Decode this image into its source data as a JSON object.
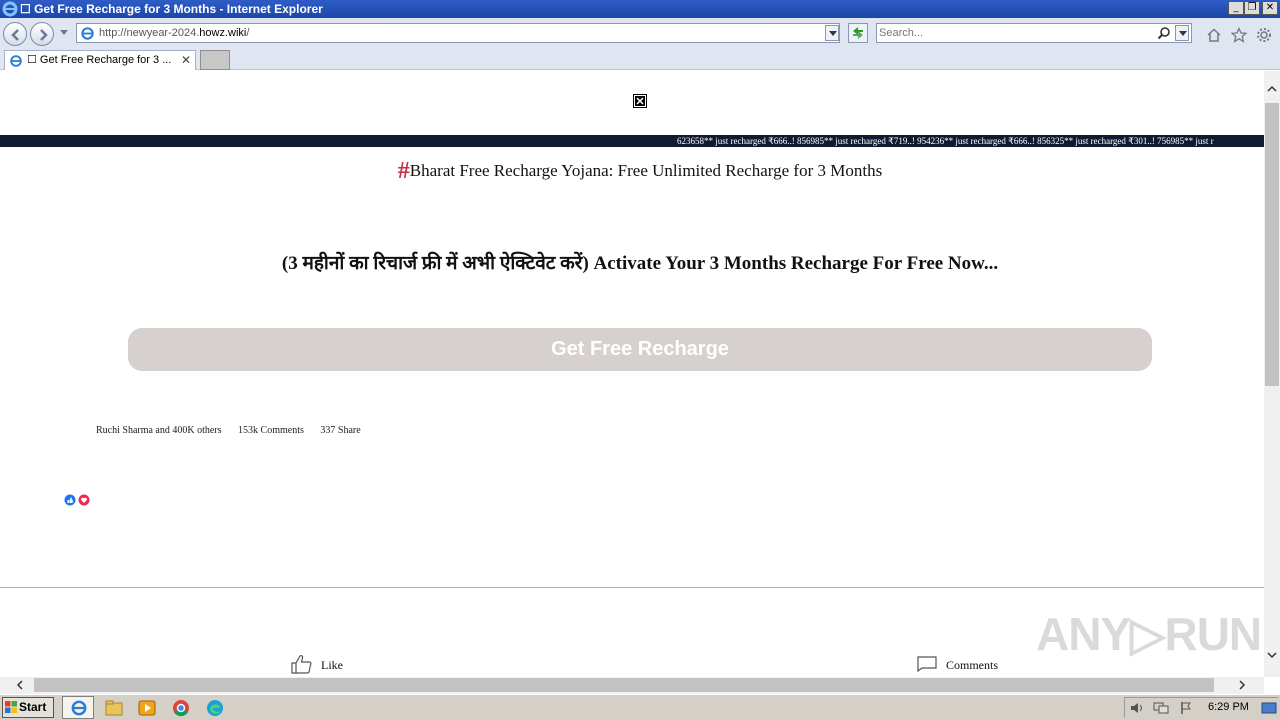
{
  "window": {
    "title": "☐ Get Free Recharge for 3 Months - Internet Explorer",
    "controls": {
      "minimize": "_",
      "restore": "❐",
      "close": "✕"
    }
  },
  "navbar": {
    "url_prefix": "http://newyear-2024.",
    "url_domain": "howz.wiki",
    "url_suffix": "/",
    "search_placeholder": "Search..."
  },
  "tabs": [
    {
      "label": "☐ Get Free Recharge for 3 ...",
      "close": "✕"
    }
  ],
  "page": {
    "ticker": "623658** just recharged ₹666..! 856985** just recharged ₹719..! 954236** just recharged ₹666..! 856325** just recharged ₹301..! 756985** just r",
    "heading_hash": "#",
    "heading": "Bharat Free Recharge Yojana: Free Unlimited Recharge for 3 Months",
    "subheading": "(3 महीनों का रिचार्ज फ्री में अभी ऐक्टिवेट करें) Activate Your 3 Months Recharge For Free Now...",
    "cta_label": "Get Free Recharge",
    "social": {
      "likes": "Ruchi Sharma and 400K others",
      "comments": "153k  Comments",
      "shares": "337  Share"
    },
    "like_label": "Like",
    "comments_label": "Comments",
    "watermark": "ANY▷RUN"
  },
  "taskbar": {
    "start_label": "Start",
    "clock": "6:29 PM"
  },
  "icons": {
    "back": "back-arrow-icon",
    "forward": "forward-arrow-icon",
    "home": "home-icon",
    "favorites": "star-icon",
    "tools": "gear-icon",
    "search": "search-icon",
    "refresh": "refresh-icon"
  },
  "colors": {
    "titlebar": "#1c47a8",
    "ticker_bg": "#0f1a33",
    "hash": "#c0324a",
    "cta_bg": "#d6d1ce",
    "taskbar": "#d4d0c8"
  }
}
